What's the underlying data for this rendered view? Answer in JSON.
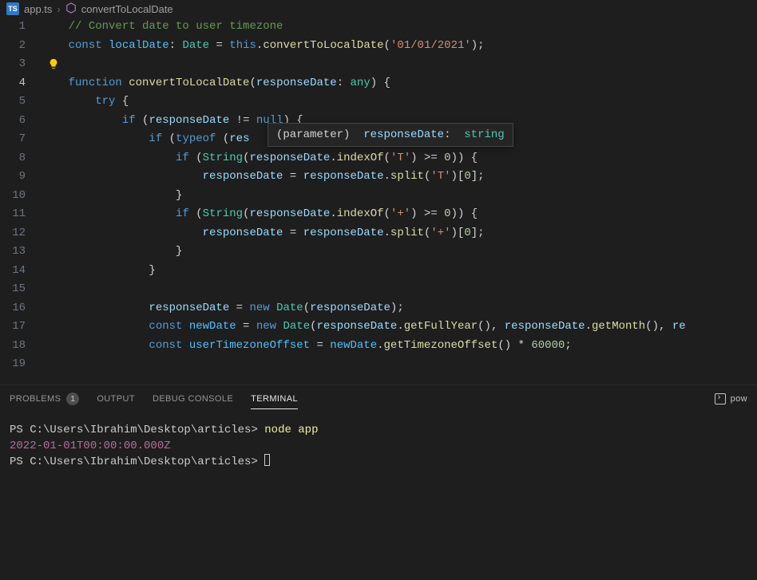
{
  "breadcrumb": {
    "file_badge": "TS",
    "file_name": "app.ts",
    "separator": "›",
    "symbol": "convertToLocalDate"
  },
  "hover": {
    "kind": "(parameter)",
    "name": "responseDate",
    "colon": ":",
    "type": "string"
  },
  "lines": [
    {
      "no": "1",
      "tokens": [
        [
          "    ",
          "punct"
        ],
        [
          "// Convert date to user timezone",
          "comment"
        ]
      ]
    },
    {
      "no": "2",
      "tokens": [
        [
          "    ",
          "punct"
        ],
        [
          "const ",
          "keyword"
        ],
        [
          "localDate",
          "const"
        ],
        [
          ": ",
          "punct"
        ],
        [
          "Date",
          "type"
        ],
        [
          " = ",
          "op"
        ],
        [
          "this",
          "this"
        ],
        [
          ".",
          "punct"
        ],
        [
          "convertToLocalDate",
          "func"
        ],
        [
          "(",
          "punct"
        ],
        [
          "'01/01/2021'",
          "string"
        ],
        [
          ");",
          "punct"
        ]
      ]
    },
    {
      "no": "3",
      "tokens": []
    },
    {
      "no": "4",
      "tokens": [
        [
          "    ",
          "punct"
        ],
        [
          "function ",
          "keyword"
        ],
        [
          "convertToLocalDate",
          "func"
        ],
        [
          "(",
          "punct"
        ],
        [
          "responseDate",
          "var"
        ],
        [
          ": ",
          "punct"
        ],
        [
          "any",
          "type"
        ],
        [
          ") {",
          "punct"
        ]
      ],
      "active": true
    },
    {
      "no": "5",
      "tokens": [
        [
          "        ",
          "punct"
        ],
        [
          "try ",
          "keyword"
        ],
        [
          "{",
          "punct"
        ]
      ]
    },
    {
      "no": "6",
      "tokens": [
        [
          "            ",
          "punct"
        ],
        [
          "if ",
          "keyword"
        ],
        [
          "(",
          "punct"
        ],
        [
          "responseDate",
          "var"
        ],
        [
          " != ",
          "op"
        ],
        [
          "null",
          "null"
        ],
        [
          ") {",
          "punct"
        ]
      ]
    },
    {
      "no": "7",
      "tokens": [
        [
          "                ",
          "punct"
        ],
        [
          "if ",
          "keyword"
        ],
        [
          "(",
          "punct"
        ],
        [
          "typeof ",
          "keyword"
        ],
        [
          "(",
          "punct"
        ],
        [
          "res",
          "var"
        ]
      ]
    },
    {
      "no": "8",
      "tokens": [
        [
          "                    ",
          "punct"
        ],
        [
          "if ",
          "keyword"
        ],
        [
          "(",
          "punct"
        ],
        [
          "String",
          "type"
        ],
        [
          "(",
          "punct"
        ],
        [
          "responseDate",
          "var"
        ],
        [
          ".",
          "punct"
        ],
        [
          "indexOf",
          "func"
        ],
        [
          "(",
          "punct"
        ],
        [
          "'T'",
          "string"
        ],
        [
          ") >= ",
          "op"
        ],
        [
          "0",
          "number"
        ],
        [
          ")) {",
          "punct"
        ]
      ]
    },
    {
      "no": "9",
      "tokens": [
        [
          "                        ",
          "punct"
        ],
        [
          "responseDate",
          "var"
        ],
        [
          " = ",
          "op"
        ],
        [
          "responseDate",
          "var"
        ],
        [
          ".",
          "punct"
        ],
        [
          "split",
          "func"
        ],
        [
          "(",
          "punct"
        ],
        [
          "'T'",
          "string"
        ],
        [
          ")[",
          "punct"
        ],
        [
          "0",
          "number"
        ],
        [
          "];",
          "punct"
        ]
      ]
    },
    {
      "no": "10",
      "tokens": [
        [
          "                    }",
          "punct"
        ]
      ]
    },
    {
      "no": "11",
      "tokens": [
        [
          "                    ",
          "punct"
        ],
        [
          "if ",
          "keyword"
        ],
        [
          "(",
          "punct"
        ],
        [
          "String",
          "type"
        ],
        [
          "(",
          "punct"
        ],
        [
          "responseDate",
          "var"
        ],
        [
          ".",
          "punct"
        ],
        [
          "indexOf",
          "func"
        ],
        [
          "(",
          "punct"
        ],
        [
          "'+'",
          "string"
        ],
        [
          ") >= ",
          "op"
        ],
        [
          "0",
          "number"
        ],
        [
          ")) {",
          "punct"
        ]
      ]
    },
    {
      "no": "12",
      "tokens": [
        [
          "                        ",
          "punct"
        ],
        [
          "responseDate",
          "var"
        ],
        [
          " = ",
          "op"
        ],
        [
          "responseDate",
          "var"
        ],
        [
          ".",
          "punct"
        ],
        [
          "split",
          "func"
        ],
        [
          "(",
          "punct"
        ],
        [
          "'+'",
          "string"
        ],
        [
          ")[",
          "punct"
        ],
        [
          "0",
          "number"
        ],
        [
          "];",
          "punct"
        ]
      ]
    },
    {
      "no": "13",
      "tokens": [
        [
          "                    }",
          "punct"
        ]
      ]
    },
    {
      "no": "14",
      "tokens": [
        [
          "                }",
          "punct"
        ]
      ]
    },
    {
      "no": "15",
      "tokens": []
    },
    {
      "no": "16",
      "tokens": [
        [
          "                ",
          "punct"
        ],
        [
          "responseDate",
          "var"
        ],
        [
          " = ",
          "op"
        ],
        [
          "new ",
          "keyword"
        ],
        [
          "Date",
          "type"
        ],
        [
          "(",
          "punct"
        ],
        [
          "responseDate",
          "var"
        ],
        [
          ");",
          "punct"
        ]
      ]
    },
    {
      "no": "17",
      "tokens": [
        [
          "                ",
          "punct"
        ],
        [
          "const ",
          "keyword"
        ],
        [
          "newDate",
          "const"
        ],
        [
          " = ",
          "op"
        ],
        [
          "new ",
          "keyword"
        ],
        [
          "Date",
          "type"
        ],
        [
          "(",
          "punct"
        ],
        [
          "responseDate",
          "var"
        ],
        [
          ".",
          "punct"
        ],
        [
          "getFullYear",
          "func"
        ],
        [
          "(), ",
          "punct"
        ],
        [
          "responseDate",
          "var"
        ],
        [
          ".",
          "punct"
        ],
        [
          "getMonth",
          "func"
        ],
        [
          "(), ",
          "punct"
        ],
        [
          "re",
          "var"
        ]
      ]
    },
    {
      "no": "18",
      "tokens": [
        [
          "                ",
          "punct"
        ],
        [
          "const ",
          "keyword"
        ],
        [
          "userTimezoneOffset",
          "const"
        ],
        [
          " = ",
          "op"
        ],
        [
          "newDate",
          "const"
        ],
        [
          ".",
          "punct"
        ],
        [
          "getTimezoneOffset",
          "func"
        ],
        [
          "() * ",
          "op"
        ],
        [
          "60000",
          "number"
        ],
        [
          ";",
          "punct"
        ]
      ]
    },
    {
      "no": "19",
      "tokens": []
    }
  ],
  "panel": {
    "tabs": {
      "problems": "PROBLEMS",
      "problems_count": "1",
      "output": "OUTPUT",
      "debug": "DEBUG CONSOLE",
      "terminal": "TERMINAL"
    },
    "right_label": "pow"
  },
  "terminal": {
    "line1_prompt": "PS C:\\Users\\Ibrahim\\Desktop\\articles> ",
    "line1_cmd": "node app",
    "line2_output": "2022-01-01T00:00:00.000Z",
    "line3_prompt": "PS C:\\Users\\Ibrahim\\Desktop\\articles> "
  }
}
